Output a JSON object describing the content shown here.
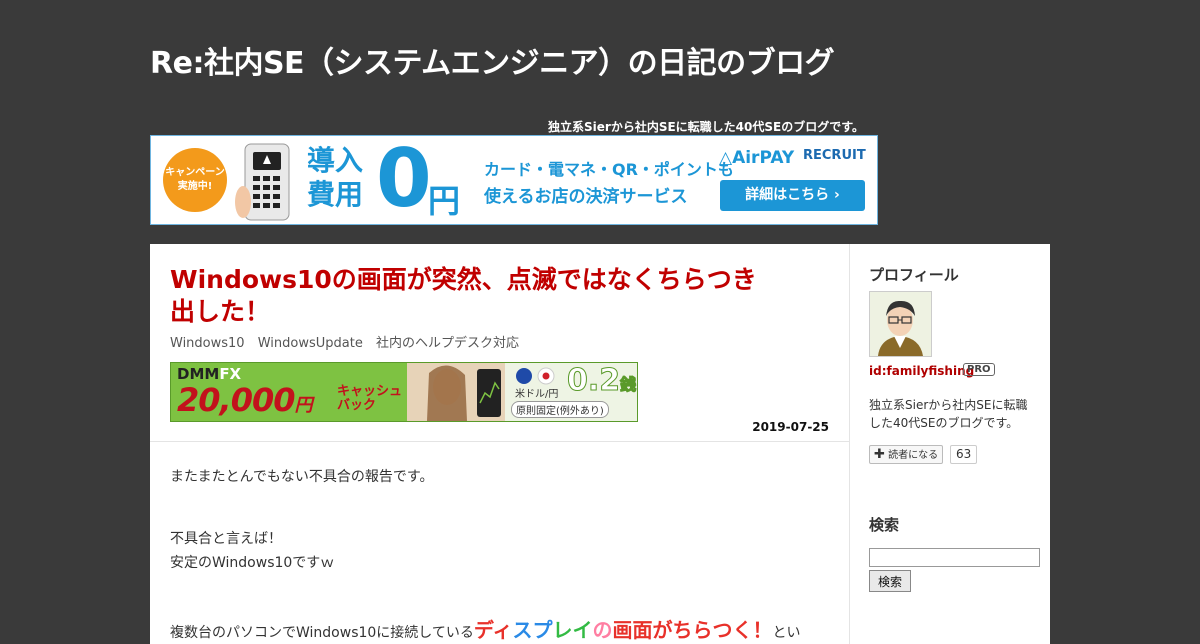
{
  "blog": {
    "title": "Re:社内SE（システムエンジニア）の日記のブログ",
    "description": "独立系Sierから社内SEに転職した40代SEのブログです。"
  },
  "top_ad": {
    "campaign": "キャンペーン実施中!",
    "campaign_line1": "キャンペーン",
    "campaign_line2": "実施中!",
    "headline_1": "導入",
    "headline_2": "費用",
    "zero": "0",
    "yen": "円",
    "line1": "カード・電マネ・QR・ポイントも",
    "line2": "使えるお店の決済サービス",
    "brand1": "AirPAY",
    "brand2": "RECRUIT",
    "cta": "詳細はこちら ›",
    "colors": {
      "accent": "#1c96d6",
      "badge": "#f39a1b"
    }
  },
  "entry": {
    "title": "Windows10の画面が突然、点滅ではなくちらつき出した！",
    "categories": [
      "Windows10",
      "WindowsUpdate",
      "社内のヘルプデスク対応"
    ],
    "date": "2019-07-25",
    "paragraphs": {
      "p1": "またまたとんでもない不具合の報告です。",
      "p2": "不具合と言えば！",
      "p3": "安定のWindows10ですｗ",
      "p4_prefix": "複数台のパソコンでWindows10に接続している",
      "p4_h1": "ディ",
      "p4_h2": "ス",
      "p4_h3": "プ",
      "p4_h4": "レイ",
      "p4_h5": "の",
      "p4_h6": "画面がちらつく！",
      "p4_suffix": "とい"
    },
    "colors": {
      "title": "#c00000"
    }
  },
  "fx_ad": {
    "logo_main": "DMM",
    "logo_sub": "FX",
    "amount": "20,000",
    "amount_unit": "円",
    "cash_line1": "キャッシュ",
    "cash_line2": "バック",
    "pair": "米ドル/円",
    "spread": "0.2",
    "spread_unit": "銭",
    "note": "原則固定(例外あり)"
  },
  "sidebar": {
    "profile_heading": "プロフィール",
    "profile_id": "id:familyfishing",
    "pro_badge": "PRO",
    "profile_desc": "独立系Sierから社内SEに転職した40代SEのブログです。",
    "follow_label": "読者になる",
    "follow_count": "63",
    "search_heading": "検索",
    "search_button": "検索",
    "search_value": ""
  }
}
